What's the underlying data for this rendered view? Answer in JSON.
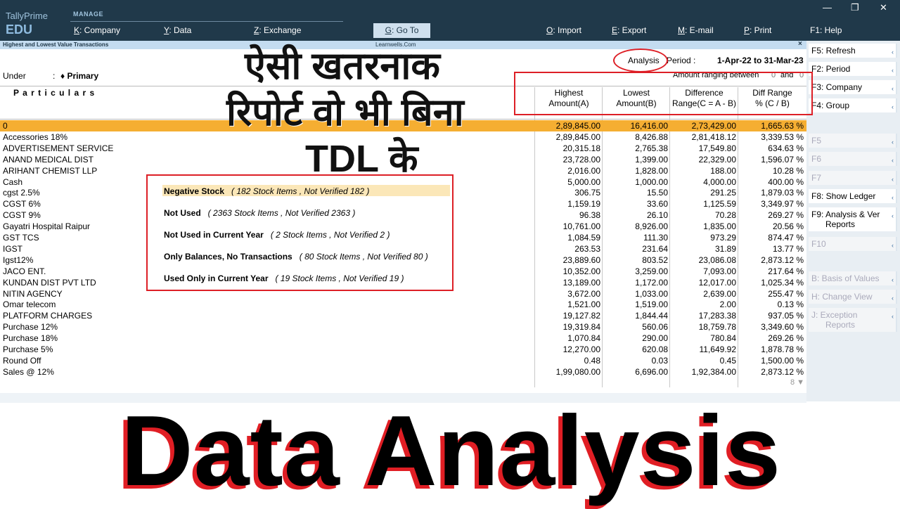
{
  "app": {
    "brand": "TallyPrime",
    "edition": "EDU",
    "manage_label": "MANAGE"
  },
  "menu": [
    {
      "key": "K",
      "label": ": Company"
    },
    {
      "key": "Y",
      "label": ": Data"
    },
    {
      "key": "Z",
      "label": ": Exchange"
    },
    {
      "key": "G",
      "label": ": Go To"
    },
    {
      "key": "O",
      "label": ": Import"
    },
    {
      "key": "E",
      "label": ": Export"
    },
    {
      "key": "M",
      "label": ": E-mail"
    },
    {
      "key": "P",
      "label": ": Print"
    },
    {
      "key": "F1",
      "label": ": Help"
    }
  ],
  "window_controls": {
    "minimize": "—",
    "restore": "❐",
    "close": "✕"
  },
  "report": {
    "title": "Highest and Lowest Value Transactions",
    "center_label": "Learnwells.Com",
    "close_label": "×",
    "analysis_label": "Analysis",
    "period_label": "Period :",
    "period_value": "1-Apr-22 to 31-Mar-23",
    "amount_ranging_label": "Amount ranging between",
    "range_from": "0",
    "range_and": "and",
    "range_to": "0",
    "under_label": "Under",
    "under_colon": ":",
    "under_value": "♦ Primary",
    "particulars_label": "P a r t i c u l a r s",
    "columns": [
      {
        "line1": "Highest",
        "line2": "Amount(A)"
      },
      {
        "line1": "Lowest",
        "line2": "Amount(B)"
      },
      {
        "line1": "Difference",
        "line2": "Range(C = A - B)"
      },
      {
        "line1": "Diff Range",
        "line2": "% (C / B)"
      }
    ],
    "rows": [
      {
        "name": "0",
        "highest": "2,89,845.00",
        "lowest": "16,416.00",
        "difference": "2,73,429.00",
        "pct": "1,665.63 %"
      },
      {
        "name": "Accessories 18%",
        "highest": "2,89,845.00",
        "lowest": "8,426.88",
        "difference": "2,81,418.12",
        "pct": "3,339.53 %"
      },
      {
        "name": "ADVERTISEMENT SERVICE",
        "highest": "20,315.18",
        "lowest": "2,765.38",
        "difference": "17,549.80",
        "pct": "634.63 %"
      },
      {
        "name": "ANAND MEDICAL DIST",
        "highest": "23,728.00",
        "lowest": "1,399.00",
        "difference": "22,329.00",
        "pct": "1,596.07 %"
      },
      {
        "name": "ARIHANT CHEMIST LLP",
        "highest": "2,016.00",
        "lowest": "1,828.00",
        "difference": "188.00",
        "pct": "10.28 %"
      },
      {
        "name": "Cash",
        "highest": "5,000.00",
        "lowest": "1,000.00",
        "difference": "4,000.00",
        "pct": "400.00 %"
      },
      {
        "name": "cgst 2.5%",
        "highest": "306.75",
        "lowest": "15.50",
        "difference": "291.25",
        "pct": "1,879.03 %"
      },
      {
        "name": "CGST 6%",
        "highest": "1,159.19",
        "lowest": "33.60",
        "difference": "1,125.59",
        "pct": "3,349.97 %"
      },
      {
        "name": "CGST 9%",
        "highest": "96.38",
        "lowest": "26.10",
        "difference": "70.28",
        "pct": "269.27 %"
      },
      {
        "name": "Gayatri Hospital Raipur",
        "highest": "10,761.00",
        "lowest": "8,926.00",
        "difference": "1,835.00",
        "pct": "20.56 %"
      },
      {
        "name": "GST TCS",
        "highest": "1,084.59",
        "lowest": "111.30",
        "difference": "973.29",
        "pct": "874.47 %"
      },
      {
        "name": "IGST",
        "highest": "263.53",
        "lowest": "231.64",
        "difference": "31.89",
        "pct": "13.77 %"
      },
      {
        "name": "Igst12%",
        "highest": "23,889.60",
        "lowest": "803.52",
        "difference": "23,086.08",
        "pct": "2,873.12 %"
      },
      {
        "name": "JACO ENT.",
        "highest": "10,352.00",
        "lowest": "3,259.00",
        "difference": "7,093.00",
        "pct": "217.64 %"
      },
      {
        "name": "KUNDAN DIST PVT LTD",
        "highest": "13,189.00",
        "lowest": "1,172.00",
        "difference": "12,017.00",
        "pct": "1,025.34 %"
      },
      {
        "name": "NITIN AGENCY",
        "highest": "3,672.00",
        "lowest": "1,033.00",
        "difference": "2,639.00",
        "pct": "255.47 %"
      },
      {
        "name": "Omar telecom",
        "highest": "1,521.00",
        "lowest": "1,519.00",
        "difference": "2.00",
        "pct": "0.13 %"
      },
      {
        "name": "PLATFORM CHARGES",
        "highest": "19,127.82",
        "lowest": "1,844.44",
        "difference": "17,283.38",
        "pct": "937.05 %"
      },
      {
        "name": "Purchase 12%",
        "highest": "19,319.84",
        "lowest": "560.06",
        "difference": "18,759.78",
        "pct": "3,349.60 %"
      },
      {
        "name": "Purchase 18%",
        "highest": "1,070.84",
        "lowest": "290.00",
        "difference": "780.84",
        "pct": "269.26 %"
      },
      {
        "name": "Purchase 5%",
        "highest": "12,270.00",
        "lowest": "620.08",
        "difference": "11,649.92",
        "pct": "1,878.78 %"
      },
      {
        "name": "Round Off",
        "highest": "0.48",
        "lowest": "0.03",
        "difference": "0.45",
        "pct": "1,500.00 %"
      },
      {
        "name": "Sales @ 12%",
        "highest": "1,99,080.00",
        "lowest": "6,696.00",
        "difference": "1,92,384.00",
        "pct": "2,873.12 %"
      }
    ],
    "pager": "8 ▼"
  },
  "exception_popup": [
    {
      "label": "Negative Stock",
      "detail": "( 182 Stock Items , Not Verified 182 )"
    },
    {
      "label": "Not Used",
      "detail": "( 2363 Stock Items , Not Verified 2363 )"
    },
    {
      "label": "Not Used in Current Year",
      "detail": "( 2 Stock Items , Not Verified 2 )"
    },
    {
      "label": "Only Balances, No Transactions",
      "detail": "( 80 Stock Items , Not Verified 80 )"
    },
    {
      "label": "Used Only in Current Year",
      "detail": "( 19 Stock Items , Not Verified 19 )"
    }
  ],
  "sidebar": [
    {
      "label": "F5: Refresh",
      "enabled": true
    },
    {
      "label": "F2: Period",
      "enabled": true
    },
    {
      "label": "F3: Company",
      "enabled": true
    },
    {
      "label": "F4: Group",
      "enabled": true
    },
    {
      "label": "F5",
      "enabled": false
    },
    {
      "label": "F6",
      "enabled": false
    },
    {
      "label": "F7",
      "enabled": false
    },
    {
      "label": "F8: Show Ledger",
      "enabled": true
    },
    {
      "label": "F9: Analysis & Ver",
      "label2": "Reports",
      "enabled": true
    },
    {
      "label": "F10",
      "enabled": false
    },
    {
      "label": "B: Basis of Values",
      "enabled": false
    },
    {
      "label": "H: Change View",
      "enabled": false
    },
    {
      "label": "J: Exception",
      "label2": "Reports",
      "enabled": false
    }
  ],
  "overlay": {
    "hindi_line1": "ऐसी खतरनाक",
    "hindi_line2": "रिपोर्ट वो भी बिना",
    "hindi_line3": "TDL के",
    "big_title": "Data Analysis"
  },
  "colors": {
    "topbar": "#20394a",
    "highlight_row": "#f5ae32",
    "annotation_red": "#dd1f26"
  }
}
